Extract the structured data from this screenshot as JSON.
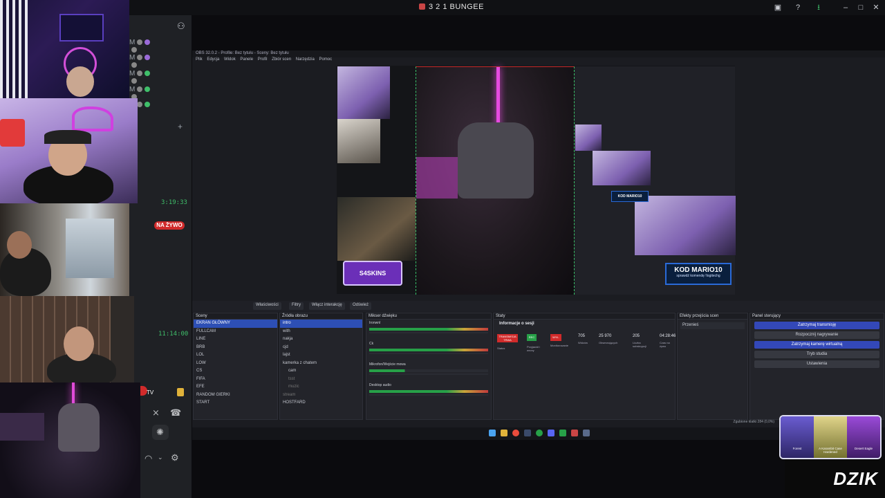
{
  "window": {
    "title": "3 2 1 BUNGEE"
  },
  "discord": {
    "timer_top": "3:19:33",
    "live_badge": "NA ŻYWO",
    "timer_mid": "11:14:00",
    "voice_letter": "M",
    "tv_label": "TV"
  },
  "obs": {
    "window_title": "OBS 32.0.2 - Profile: Bez tytułu - Sceny: Bez tytułu",
    "menu": [
      "Plik",
      "Edycja",
      "Widok",
      "Panele",
      "Profil",
      "Zbiór scen",
      "Narzędzia",
      "Pomoc"
    ],
    "control_buttons": [
      "Właściwości",
      "Filtry",
      "Włącz interakcję",
      "Odśwież"
    ],
    "scenes": {
      "header": "Sceny",
      "items": [
        "EKRAN GŁÓWNY",
        "FULLCAM",
        "LINE",
        "BRB",
        "LOL",
        "LOW",
        "CS",
        "FIFA",
        "EFE",
        "RANDOM GIERKI",
        "START",
        "HOSTFARD"
      ]
    },
    "sources": {
      "header": "Źródła obrazu",
      "items": [
        "intro",
        "with",
        "nakja",
        "cjd",
        "lajst",
        "kamerka z chatem",
        "cam",
        "tsst",
        "muzic",
        "stream",
        "HOSTFARD"
      ]
    },
    "mixer": {
      "header": "Mikser dźwięku",
      "channels": [
        "Ironwnl",
        "Ck",
        "Mikrofon/Wejście mowa",
        "Desktop audio"
      ]
    },
    "stats": {
      "header": "Staty",
      "session_title": "Informacje o sesji",
      "badges": [
        "TRANSMISJA TRWA",
        "REC",
        "WYŁ."
      ],
      "badge_labels": [
        "Status",
        "Przyjaciół i wrony",
        "Monitorowanie"
      ],
      "numbers": [
        {
          "value": "705",
          "label": "Widzów"
        },
        {
          "value": "25 970",
          "label": "Obserwujących"
        },
        {
          "value": "205",
          "label": "Liczba subskrypcji"
        },
        {
          "value": "04:28:46",
          "label": "Czas na żywo"
        }
      ]
    },
    "transitions": {
      "header": "Efekty przejścia scen",
      "value": "Przenieś"
    },
    "controls": {
      "header": "Panel sterujący",
      "buttons": [
        "Zatrzymaj transmisję",
        "Rozpocznij nagrywanie",
        "Zatrzymaj kamerę wirtualną",
        "Tryb studia",
        "Ustawienia"
      ]
    },
    "statusbar": "Zgubione klatki 284 (0,0%)",
    "overlay_codes": [
      "KOD MARIO10",
      "sprawdź komendę !logitechg"
    ],
    "overlay_brand": "S4SKINS"
  },
  "promo": {
    "items": [
      "Forest",
      "A Karambit Case Hardened",
      "Desert Eagle"
    ]
  },
  "brand": "DZIK",
  "colors": {
    "accent": "#3348b8",
    "live": "#d12b2b",
    "online": "#3fbf6a"
  }
}
